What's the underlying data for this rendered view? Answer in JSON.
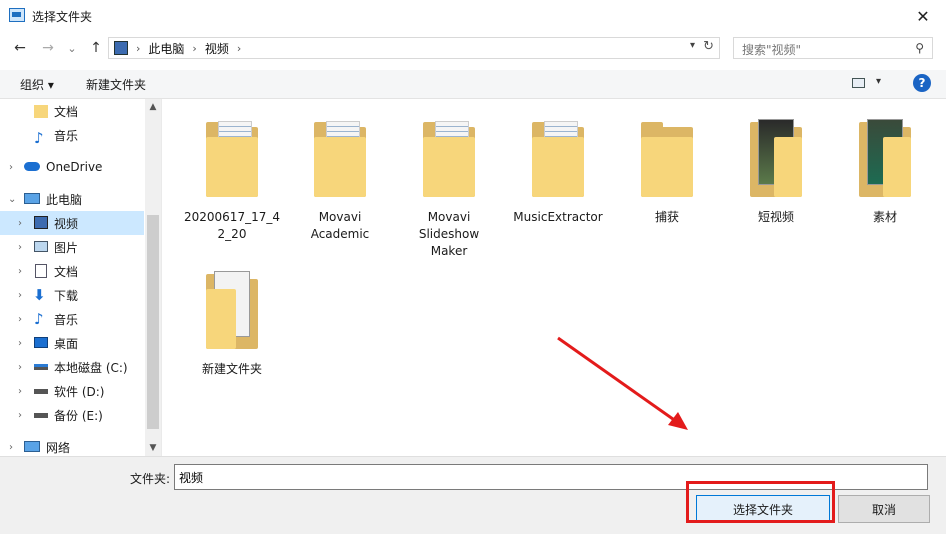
{
  "window": {
    "title": "选择文件夹",
    "close_glyph": "✕"
  },
  "nav": {
    "back_glyph": "←",
    "forward_glyph": "→",
    "recent_glyph": "⌄",
    "up_glyph": "↑",
    "breadcrumb": [
      "此电脑",
      "视频"
    ],
    "refresh_glyph": "↻",
    "search_placeholder": "搜索\"视频\""
  },
  "toolbar": {
    "organize": "组织 ▾",
    "new_folder": "新建文件夹",
    "help": "?"
  },
  "sidebar": {
    "items": [
      {
        "label": "文档",
        "icon": "document-folder-icon"
      },
      {
        "label": "音乐",
        "icon": "music-icon"
      },
      {
        "label": "OneDrive",
        "icon": "cloud-icon"
      },
      {
        "label": "此电脑",
        "icon": "computer-icon"
      },
      {
        "label": "视频",
        "icon": "video-icon",
        "selected": true
      },
      {
        "label": "图片",
        "icon": "picture-icon"
      },
      {
        "label": "文档",
        "icon": "document-icon"
      },
      {
        "label": "下载",
        "icon": "download-icon"
      },
      {
        "label": "音乐",
        "icon": "music-icon"
      },
      {
        "label": "桌面",
        "icon": "desktop-icon"
      },
      {
        "label": "本地磁盘 (C:)",
        "icon": "drive-icon"
      },
      {
        "label": "软件 (D:)",
        "icon": "drive-icon"
      },
      {
        "label": "备份 (E:)",
        "icon": "drive-icon"
      },
      {
        "label": "网络",
        "icon": "network-icon"
      }
    ]
  },
  "folders": [
    {
      "label": "20200617_17_4\n2_20"
    },
    {
      "label": "Movavi\nAcademic"
    },
    {
      "label": "Movavi\nSlideshow\nMaker"
    },
    {
      "label": "MusicExtractor"
    },
    {
      "label": "捕获"
    },
    {
      "label": "短视频"
    },
    {
      "label": "素材"
    },
    {
      "label": "新建文件夹"
    }
  ],
  "footer": {
    "filename_label": "文件夹:",
    "filename_value": "视频",
    "select_button": "选择文件夹",
    "cancel_button": "取消"
  },
  "colors": {
    "accent": "#0078d7",
    "selection": "#cce8ff",
    "annotation": "#e31b1b",
    "folder": "#f7d67b"
  }
}
